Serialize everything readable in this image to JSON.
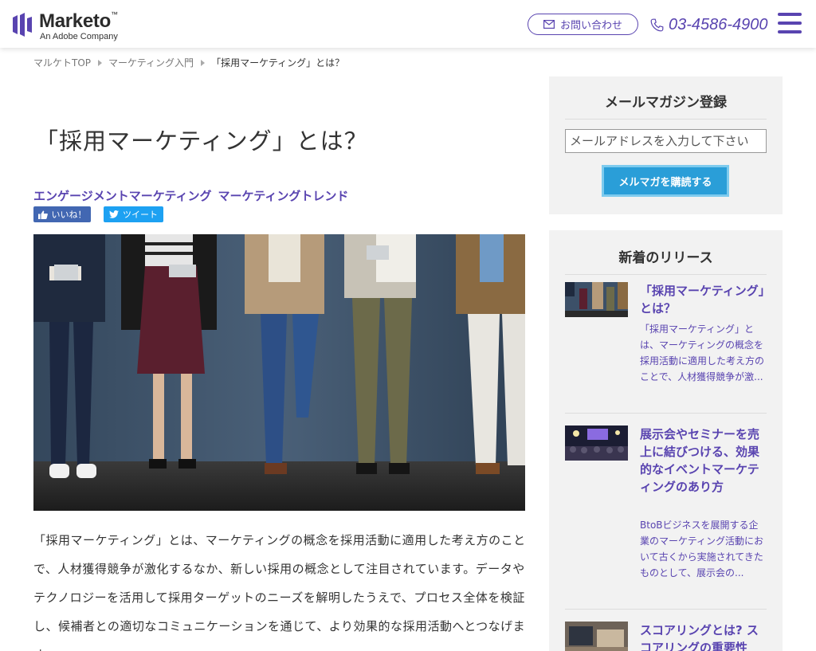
{
  "header": {
    "logo_name": "Marketo",
    "logo_tm": "™",
    "logo_sub": "An Adobe Company",
    "contact_label": "お問い合わせ",
    "phone": "03-4586-4900"
  },
  "breadcrumb": [
    "マルケトTOP",
    "マーケティング入門",
    "「採用マーケティング」とは？"
  ],
  "article": {
    "title": "「採用マーケティング」とは？",
    "tags": [
      "エンゲージメントマーケティング",
      "マーケティングトレンド"
    ],
    "like_label": "いいね！",
    "tweet_label": "ツイート",
    "body": "「採用マーケティング」とは、マーケティングの概念を採用活動に適用した考え方のことで、人材獲得競争が激化するなか、新しい採用の概念として注目されています。データやテクノロジーを活用して採用ターゲットのニーズを解明したうえで、プロセス全体を検証し、候補者との適切なコミュニケーションを通じて、より効果的な採用活動へとつなげます。"
  },
  "sidebar": {
    "newsletter_title": "メールマガジン登録",
    "email_placeholder": "メールアドレスを入力して下さい",
    "subscribe_label": "メルマガを購読する",
    "releases_title": "新着のリリース",
    "releases": [
      {
        "title": "「採用マーケティング」とは？",
        "desc": "「採用マーケティング」とは、マーケティングの概念を採用活動に適用した考え方のことで、人材獲得競争が激..."
      },
      {
        "title": "展示会やセミナーを売上に結びつける、効果的なイベントマーケティングのあり方",
        "desc": "BtoBビジネスを展開する企業のマーケティング活動において古くから実施されてきたものとして、展示会の..."
      },
      {
        "title": "スコアリングとは? スコアリングの重要性",
        "desc": ""
      }
    ]
  },
  "colors": {
    "brand": "#5944b0",
    "subscribe": "#2a9ed8",
    "facebook": "#4267b2",
    "twitter": "#1da1f2"
  }
}
